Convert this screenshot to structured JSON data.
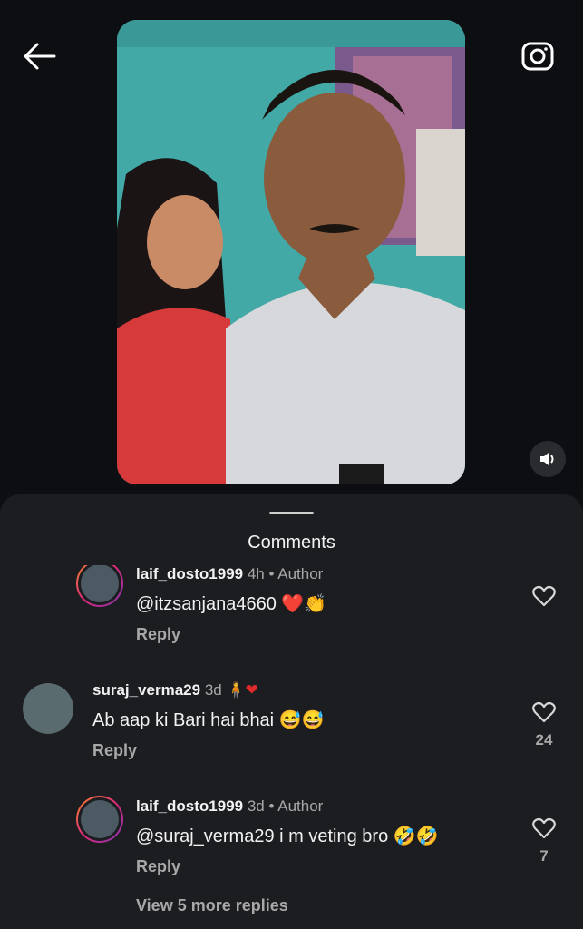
{
  "header": {
    "back_icon": "arrow-left-icon",
    "camera_icon": "camera-icon",
    "sound_icon": "speaker-icon"
  },
  "sheet": {
    "title": "Comments"
  },
  "comments": [
    {
      "username": "laif_dosto1999",
      "time": "4h",
      "role": "Author",
      "text": "@itzsanjana4660 ❤️👏",
      "reply_label": "Reply",
      "likes": ""
    },
    {
      "username": "suraj_verma29",
      "time": "3d",
      "badge": "🧍❤",
      "text": "Ab aap ki Bari hai bhai 😅😅",
      "reply_label": "Reply",
      "likes": "24"
    },
    {
      "username": "laif_dosto1999",
      "time": "3d",
      "role": "Author",
      "text": "@suraj_verma29 i m veting bro 🤣🤣",
      "reply_label": "Reply",
      "likes": "7"
    }
  ],
  "view_more": "View 5 more replies",
  "colors": {
    "sheet_bg": "#1c1d21",
    "top_bg": "#0d0e11",
    "accent_heart": "#e02b2b"
  }
}
